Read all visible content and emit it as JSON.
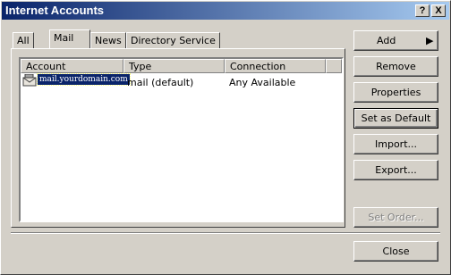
{
  "window": {
    "title": "Internet Accounts",
    "help_label": "?",
    "close_label": "X"
  },
  "tabs": [
    {
      "label": "All"
    },
    {
      "label": "Mail"
    },
    {
      "label": "News"
    },
    {
      "label": "Directory Service"
    }
  ],
  "list": {
    "columns": [
      "Account",
      "Type",
      "Connection"
    ],
    "rows": [
      {
        "account": "mail.yourdomain.com",
        "type": "mail (default)",
        "connection": "Any Available"
      }
    ]
  },
  "buttons": {
    "add": "Add",
    "remove": "Remove",
    "properties": "Properties",
    "set_default": "Set as Default",
    "import": "Import...",
    "export": "Export...",
    "set_order": "Set Order...",
    "close": "Close"
  }
}
